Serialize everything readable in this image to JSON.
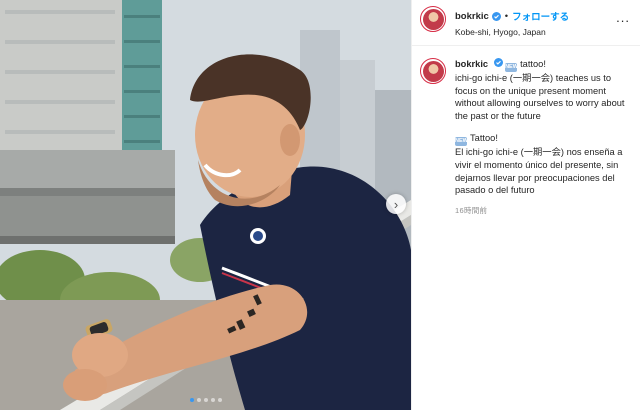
{
  "post": {
    "username": "bokrkic",
    "follow_label": "フォローする",
    "separator": "•",
    "location": "Kobe-shi, Hyogo, Japan",
    "more_label": "...",
    "caption": {
      "tag_badge": "NEW",
      "first_word": "tattoo!",
      "english": "ichi-go ichi-e (一期一会) teaches us to focus on the unique present moment without allowing ourselves to worry about the past or the future",
      "spanish_title": "Tattoo!",
      "spanish": "El ichi-go ichi-e (一期一会) nos enseña a vivir el momento único del presente, sin dejarnos llevar por preocupaciones del pasado o del futuro"
    },
    "timestamp": "16時間前"
  },
  "carousel": {
    "next_label": "›",
    "dot_count": 5,
    "active_index": 0
  },
  "colors": {
    "accent": "#0095f6",
    "avatar_ring": "#d72c45",
    "shirt": "#1c2542"
  },
  "icons": {
    "verified": "verified-badge-icon",
    "next": "chevron-right-icon",
    "more": "more-options-icon"
  }
}
